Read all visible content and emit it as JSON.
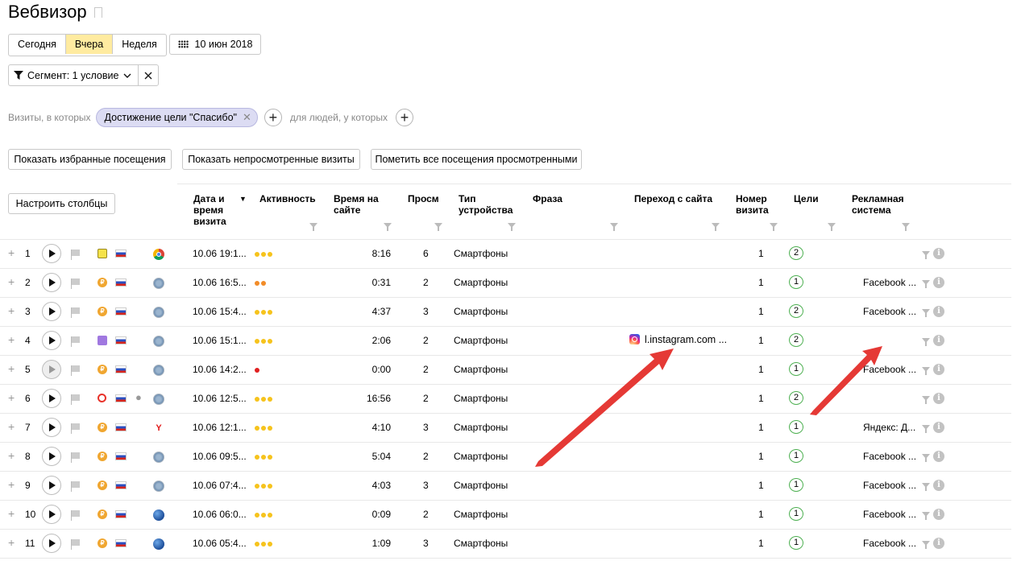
{
  "page": {
    "title": "Вебвизор"
  },
  "period": {
    "tabs": [
      "Сегодня",
      "Вчера",
      "Неделя"
    ],
    "active": "Вчера",
    "date": "10 июн 2018"
  },
  "segment": {
    "label": "Сегмент: 1 условие"
  },
  "filters": {
    "visits_prefix": "Визиты, в которых",
    "goal_chip": "Достижение цели \"Спасибо\"",
    "people_prefix": "для людей, у которых"
  },
  "actions": {
    "show_favorites": "Показать избранные посещения",
    "show_unviewed": "Показать непросмотренные визиты",
    "mark_all_viewed": "Пометить все посещения просмотренными",
    "configure_columns": "Настроить столбцы"
  },
  "columns": {
    "date": "Дата и время визита",
    "activity": "Активность",
    "time_on_site": "Время на сайте",
    "views": "Просм",
    "device_type": "Тип устройства",
    "phrase": "Фраза",
    "referrer": "Переход с сайта",
    "visit_number": "Номер визита",
    "goals": "Цели",
    "ad_system": "Рекламная система"
  },
  "colors": {
    "accent": "#ffeba0",
    "dot_yellow": "#f6c31c",
    "dot_orange": "#f28c28",
    "dot_red": "#e02020",
    "goal_green": "#4caf50",
    "arrow_red": "#e53935"
  },
  "rows": [
    {
      "n": "1",
      "source": "ad-icon",
      "browser": "chrome-icon",
      "date": "10.06 19:1...",
      "activity": 3,
      "activity_color": "yellow",
      "time": "8:16",
      "views": "6",
      "device": "Смартфоны",
      "referrer": "",
      "visit": "1",
      "goals": "2",
      "ad": "",
      "dim": false,
      "apple": false
    },
    {
      "n": "2",
      "source": "coin-icon",
      "browser": "safari-icon",
      "date": "10.06 16:5...",
      "activity": 2,
      "activity_color": "orange",
      "time": "0:31",
      "views": "2",
      "device": "Смартфоны",
      "referrer": "",
      "visit": "1",
      "goals": "1",
      "ad": "Facebook ...",
      "dim": false,
      "apple": false
    },
    {
      "n": "3",
      "source": "coin-icon",
      "browser": "safari-icon",
      "date": "10.06 15:4...",
      "activity": 3,
      "activity_color": "yellow",
      "time": "4:37",
      "views": "3",
      "device": "Смартфоны",
      "referrer": "",
      "visit": "1",
      "goals": "2",
      "ad": "Facebook ...",
      "dim": false,
      "apple": false
    },
    {
      "n": "4",
      "source": "social-icon",
      "browser": "safari-icon",
      "date": "10.06 15:1...",
      "activity": 3,
      "activity_color": "yellow",
      "time": "2:06",
      "views": "2",
      "device": "Смартфоны",
      "referrer": "l.instagram.com ...",
      "visit": "1",
      "goals": "2",
      "ad": "",
      "dim": false,
      "apple": false
    },
    {
      "n": "5",
      "source": "coin-icon",
      "browser": "safari-icon",
      "date": "10.06 14:2...",
      "activity": 1,
      "activity_color": "red",
      "time": "0:00",
      "views": "2",
      "device": "Смартфоны",
      "referrer": "",
      "visit": "1",
      "goals": "1",
      "ad": "Facebook ...",
      "dim": true,
      "apple": false
    },
    {
      "n": "6",
      "source": "search-icon",
      "browser": "safari-icon",
      "date": "10.06 12:5...",
      "activity": 3,
      "activity_color": "yellow",
      "time": "16:56",
      "views": "2",
      "device": "Смартфоны",
      "referrer": "",
      "visit": "1",
      "goals": "2",
      "ad": "",
      "dim": false,
      "apple": true
    },
    {
      "n": "7",
      "source": "coin-icon",
      "browser": "yandex-icon",
      "date": "10.06 12:1...",
      "activity": 3,
      "activity_color": "yellow",
      "time": "4:10",
      "views": "3",
      "device": "Смартфоны",
      "referrer": "",
      "visit": "1",
      "goals": "1",
      "ad": "Яндекс: Д...",
      "dim": false,
      "apple": false
    },
    {
      "n": "8",
      "source": "coin-icon",
      "browser": "safari-icon",
      "date": "10.06 09:5...",
      "activity": 3,
      "activity_color": "yellow",
      "time": "5:04",
      "views": "2",
      "device": "Смартфоны",
      "referrer": "",
      "visit": "1",
      "goals": "1",
      "ad": "Facebook ...",
      "dim": false,
      "apple": false
    },
    {
      "n": "9",
      "source": "coin-icon",
      "browser": "safari-icon",
      "date": "10.06 07:4...",
      "activity": 3,
      "activity_color": "yellow",
      "time": "4:03",
      "views": "3",
      "device": "Смартфоны",
      "referrer": "",
      "visit": "1",
      "goals": "1",
      "ad": "Facebook ...",
      "dim": false,
      "apple": false
    },
    {
      "n": "10",
      "source": "coin-icon",
      "browser": "globe-icon",
      "date": "10.06 06:0...",
      "activity": 3,
      "activity_color": "yellow",
      "time": "0:09",
      "views": "2",
      "device": "Смартфоны",
      "referrer": "",
      "visit": "1",
      "goals": "1",
      "ad": "Facebook ...",
      "dim": false,
      "apple": false
    },
    {
      "n": "11",
      "source": "coin-icon",
      "browser": "globe-icon",
      "date": "10.06 05:4...",
      "activity": 3,
      "activity_color": "yellow",
      "time": "1:09",
      "views": "3",
      "device": "Смартфоны",
      "referrer": "",
      "visit": "1",
      "goals": "1",
      "ad": "Facebook ...",
      "dim": false,
      "apple": false
    }
  ]
}
